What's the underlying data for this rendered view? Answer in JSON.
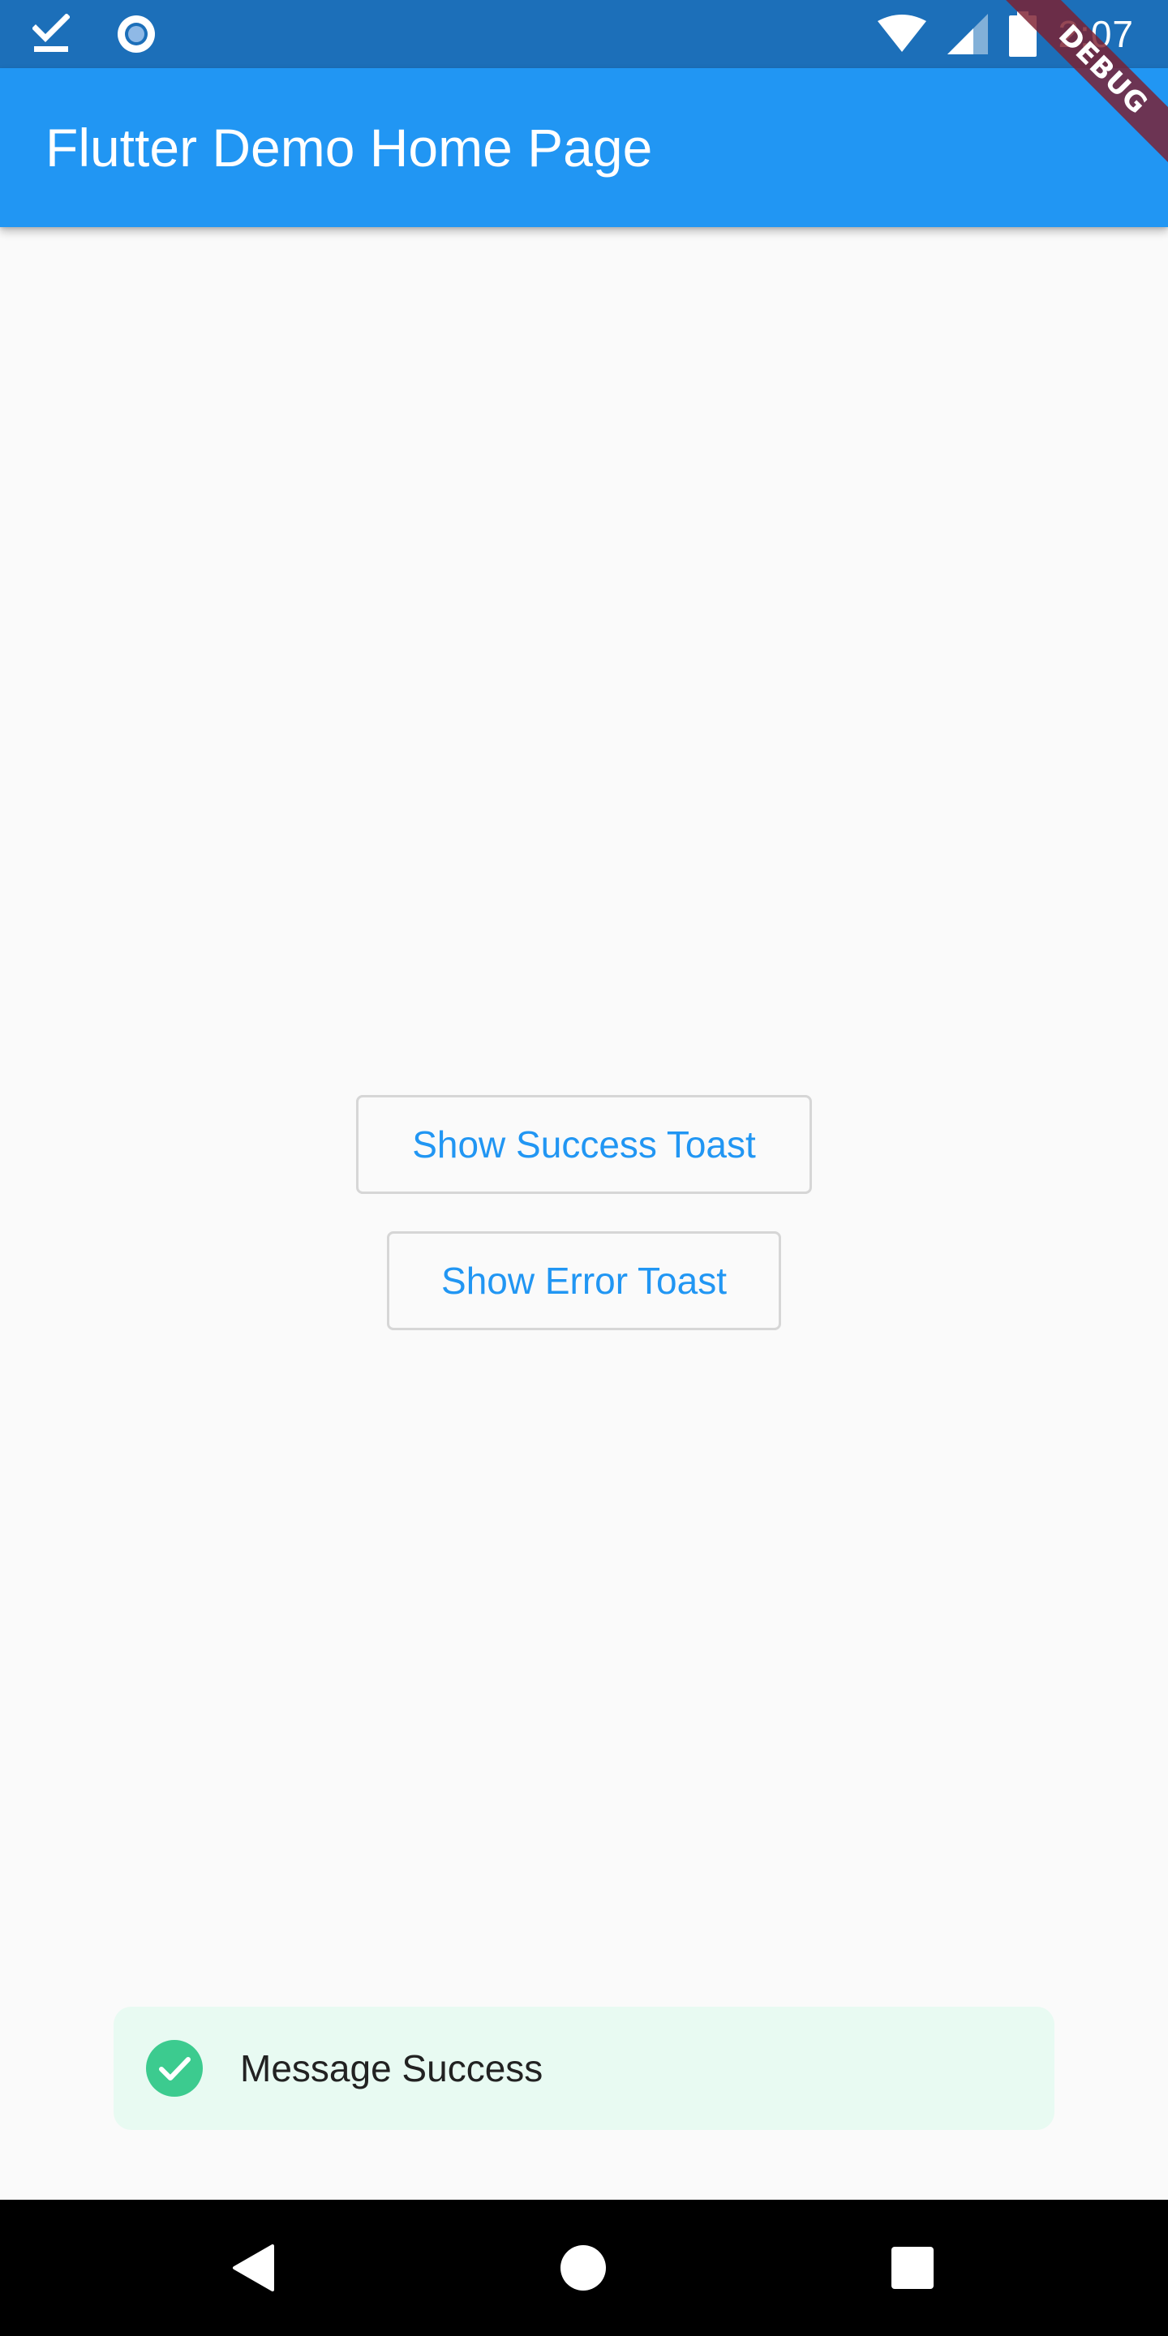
{
  "status_bar": {
    "time": "2:07",
    "icons": [
      "download-check-icon",
      "record-icon",
      "wifi-icon",
      "signal-icon",
      "battery-icon"
    ],
    "background": "#1c6fb9"
  },
  "app_bar": {
    "title": "Flutter Demo Home Page",
    "background": "#2196f3"
  },
  "debug_banner": {
    "label": "DEBUG",
    "color": "#7c1e30"
  },
  "main": {
    "buttons": [
      {
        "label": "Show Success Toast"
      },
      {
        "label": "Show Error Toast"
      }
    ],
    "accent": "#2196f3"
  },
  "toast": {
    "message": "Message Success",
    "icon": "check-circle-icon",
    "icon_color": "#3ccb8f",
    "background": "#e8faf2"
  },
  "nav_bar": {
    "icons": [
      "back-icon",
      "home-icon",
      "recent-apps-icon"
    ]
  }
}
